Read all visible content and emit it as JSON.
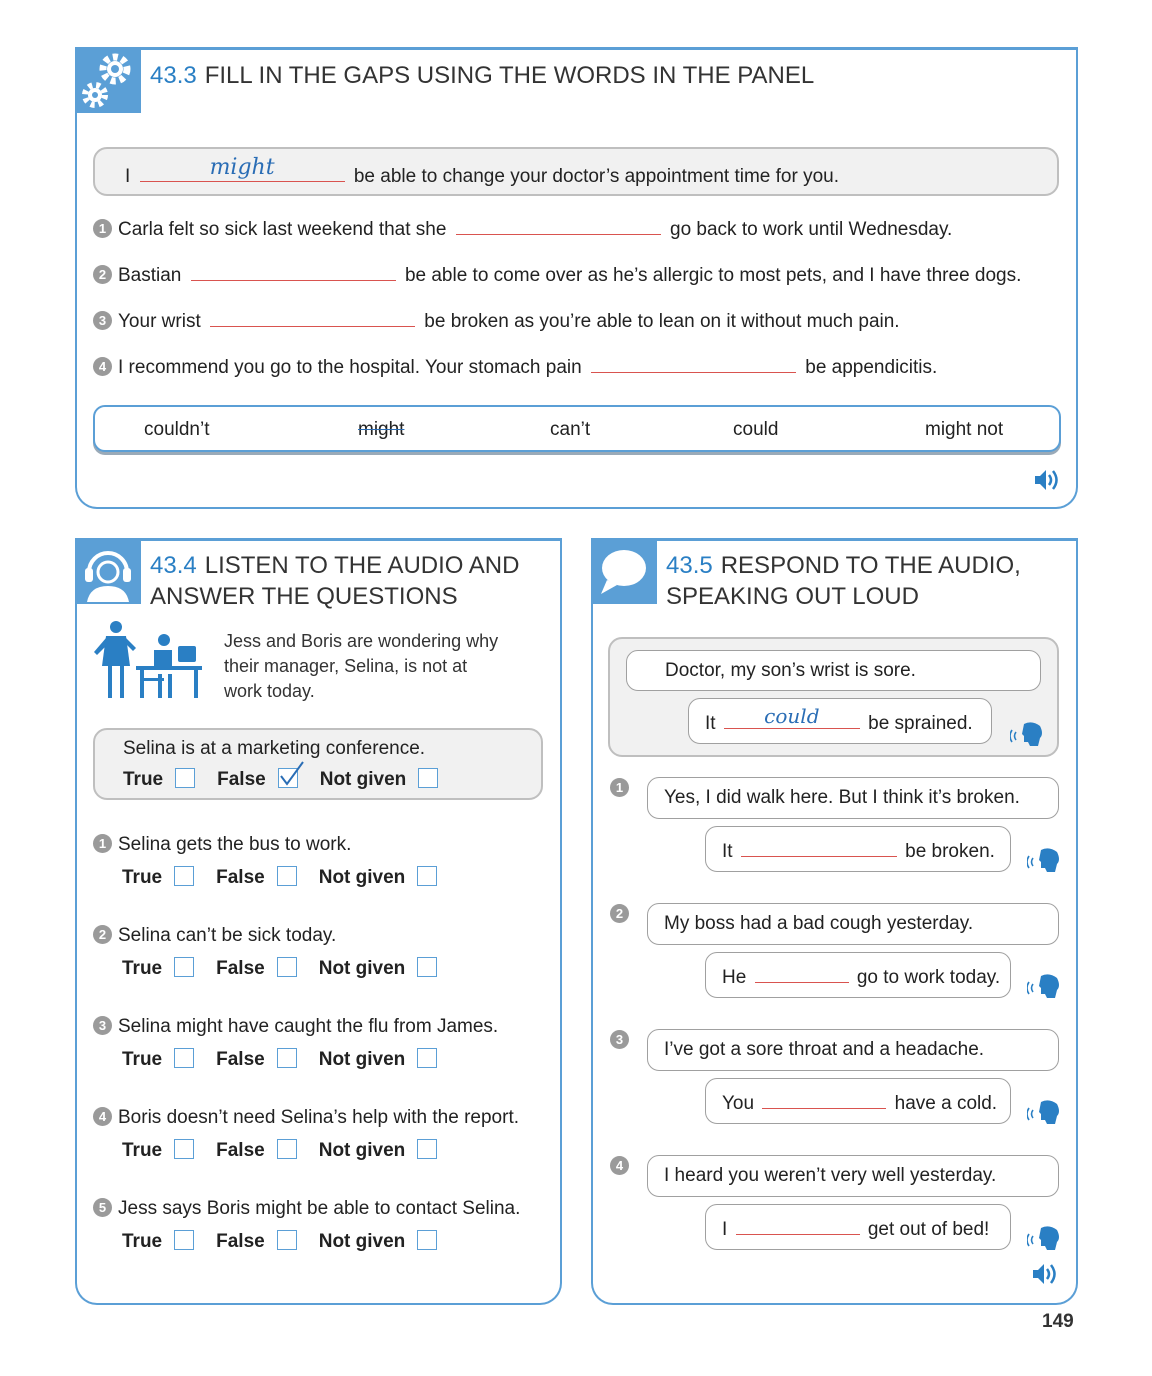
{
  "ex433": {
    "number": "43.3",
    "title": "FILL IN THE GAPS USING THE WORDS IN THE PANEL",
    "example": {
      "pre": "I",
      "answer": "might",
      "post": "be able to change your doctor’s appointment time for you."
    },
    "items": [
      {
        "n": "1",
        "pre": "Carla felt so sick last weekend that she",
        "post": "go back to work until Wednesday."
      },
      {
        "n": "2",
        "pre": "Bastian",
        "post": "be able to come over as he’s allergic to most pets, and I have three dogs."
      },
      {
        "n": "3",
        "pre": "Your wrist",
        "post": "be broken as you’re able to lean on it without much pain."
      },
      {
        "n": "4",
        "pre": "I recommend you go to the hospital. Your stomach pain",
        "post": "be appendicitis."
      }
    ],
    "words": [
      "couldn’t",
      "might",
      "can’t",
      "could",
      "might not"
    ]
  },
  "ex434": {
    "number": "43.4",
    "title_line1": "LISTEN TO THE AUDIO AND",
    "title_line2": "ANSWER THE QUESTIONS",
    "intro_line1": "Jess and Boris are wondering why",
    "intro_line2": "their manager, Selina, is not at",
    "intro_line3": "work today.",
    "example": "Selina is at a marketing conference.",
    "options": {
      "true": "True",
      "false": "False",
      "not_given": "Not given"
    },
    "items": [
      {
        "n": "1",
        "text": "Selina gets the bus to work."
      },
      {
        "n": "2",
        "text": "Selina can’t be sick today."
      },
      {
        "n": "3",
        "text": "Selina might have caught the flu from James."
      },
      {
        "n": "4",
        "text": "Boris doesn’t need Selina’s help with the report."
      },
      {
        "n": "5",
        "text": "Jess says Boris might be able to contact Selina."
      }
    ]
  },
  "ex435": {
    "number": "43.5",
    "title_line1": "RESPOND TO THE AUDIO,",
    "title_line2": "SPEAKING OUT LOUD",
    "example": {
      "prompt": "Doctor, my son’s wrist is sore.",
      "pre": "It",
      "answer": "could",
      "post": "be sprained."
    },
    "items": [
      {
        "n": "1",
        "prompt": "Yes, I did walk here. But I think it’s broken.",
        "pre": "It",
        "post": "be broken."
      },
      {
        "n": "2",
        "prompt": "My boss had a bad cough yesterday.",
        "pre": "He",
        "post": "go to work today."
      },
      {
        "n": "3",
        "prompt": "I’ve got a sore throat and a headache.",
        "pre": "You",
        "post": "have a cold."
      },
      {
        "n": "4",
        "prompt": "I heard you weren’t very well yesterday.",
        "pre": "I",
        "post": "get out of bed!"
      }
    ]
  },
  "page_number": "149",
  "colors": {
    "accent": "#5b9fd6",
    "number": "#2a7fc4",
    "gap_line": "#d9534f",
    "handwriting": "#2a6db5"
  }
}
